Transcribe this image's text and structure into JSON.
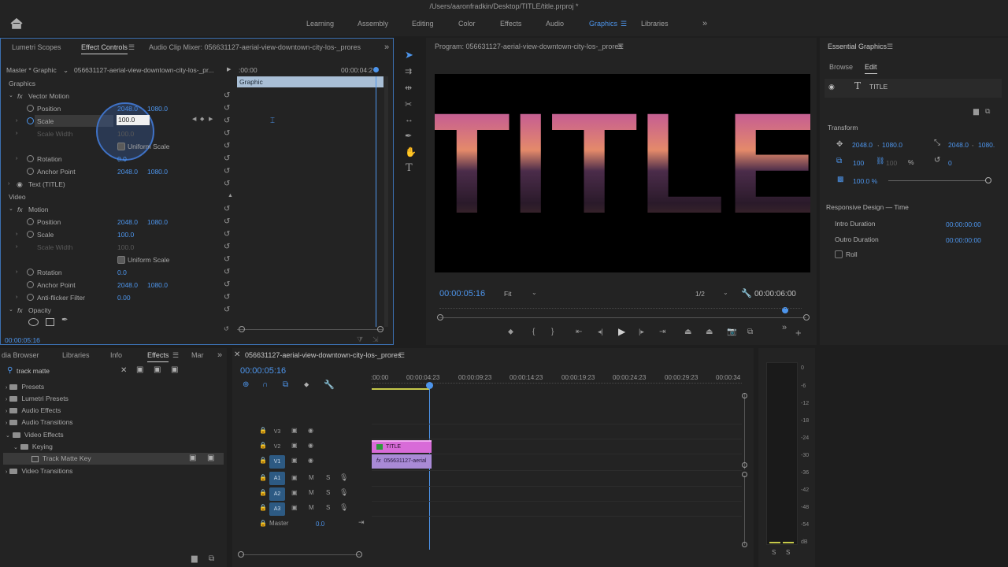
{
  "window": {
    "title": "/Users/aaronfradkin/Desktop/TITLE/title.prproj *"
  },
  "workspaces": [
    "Learning",
    "Assembly",
    "Editing",
    "Color",
    "Effects",
    "Audio",
    "Graphics",
    "Libraries"
  ],
  "overflow": "»",
  "effect_panel": {
    "tabs": [
      "Lumetri Scopes",
      "Effect Controls",
      "Audio Clip Mixer: 056631127-aerial-view-downtown-city-los-_prores"
    ],
    "source": "Master * Graphic",
    "clip": "056631127-aerial-view-downtown-city-los-_pr...",
    "time_start": ":00:00",
    "time_end": "00:00:04:2",
    "graphic_bar": "Graphic",
    "sections": {
      "graphics": "Graphics",
      "vector_motion": "Vector Motion",
      "text": "Text (TITLE)",
      "video": "Video",
      "motion": "Motion",
      "anti_flicker": "Anti-flicker Filter",
      "opacity": "Opacity"
    },
    "vector": {
      "position_label": "Position",
      "pos_x": "2048.0",
      "pos_y": "1080.0",
      "scale_label": "Scale",
      "scale_value": "100.0",
      "scale_width_label": "Scale Width",
      "scale_width_value": "100.0",
      "uniform": "Uniform Scale",
      "rotation_label": "Rotation",
      "rotation_value": "0.0",
      "anchor_label": "Anchor Point",
      "anchor_x": "2048.0",
      "anchor_y": "1080.0"
    },
    "motion": {
      "position_label": "Position",
      "pos_x": "2048.0",
      "pos_y": "1080.0",
      "scale_label": "Scale",
      "scale_value": "100.0",
      "scale_width_label": "Scale Width",
      "scale_width_value": "100.0",
      "uniform": "Uniform Scale",
      "rotation_label": "Rotation",
      "rotation_value": "0.0",
      "anchor_label": "Anchor Point",
      "anchor_x": "2048.0",
      "anchor_y": "1080.0",
      "anti_value": "0.00"
    },
    "footer_time": "00:00:05:16"
  },
  "program": {
    "title": "Program: 056631127-aerial-view-downtown-city-los-_prores",
    "title_text": "TITLE",
    "timecode": "00:00:05:16",
    "fit": "Fit",
    "resolution": "1/2",
    "duration": "00:00:06:00"
  },
  "essential": {
    "title": "Essential Graphics",
    "tabs": [
      "Browse",
      "Edit"
    ],
    "layer": "TITLE",
    "transform_label": "Transform",
    "pos_x": "2048.0",
    "pos_y": "1080.0",
    "anchor_x": "2048.0",
    "anchor_y": "1080.",
    "scale": "100",
    "scale2": "100",
    "pct": "%",
    "rotation": "0",
    "opacity": "100.0 %",
    "responsive": "Responsive Design — Time",
    "intro_label": "Intro Duration",
    "intro_value": "00:00:00:00",
    "outro_label": "Outro Duration",
    "outro_value": "00:00:00:00",
    "roll": "Roll"
  },
  "effects_browser": {
    "tabs": [
      "dia Browser",
      "Libraries",
      "Info",
      "Effects",
      "Mar"
    ],
    "search": "track matte",
    "items": [
      {
        "label": "Presets",
        "level": 0
      },
      {
        "label": "Lumetri Presets",
        "level": 0
      },
      {
        "label": "Audio Effects",
        "level": 0
      },
      {
        "label": "Audio Transitions",
        "level": 0
      },
      {
        "label": "Video Effects",
        "level": 0
      },
      {
        "label": "Keying",
        "level": 1
      },
      {
        "label": "Track Matte Key",
        "level": 2
      },
      {
        "label": "Video Transitions",
        "level": 0
      }
    ]
  },
  "timeline": {
    "title": "056631127-aerial-view-downtown-city-los-_prores",
    "timecode": "00:00:05:16",
    "ruler": [
      ":00:00",
      "00:00:04:23",
      "00:00:09:23",
      "00:00:14:23",
      "00:00:19:23",
      "00:00:24:23",
      "00:00:29:23",
      "00:00:34"
    ],
    "video_tracks": [
      "V3",
      "V2",
      "V1"
    ],
    "audio_tracks": [
      "A1",
      "A2",
      "A3"
    ],
    "master": "Master",
    "master_value": "0.0",
    "clip_title": "TITLE",
    "clip_video": "056631127-aerial",
    "meter_labels": [
      "0",
      "-6",
      "-12",
      "-18",
      "-24",
      "-30",
      "-36",
      "-42",
      "-48",
      "-54",
      "dB"
    ],
    "meter_solo": [
      "S",
      "S"
    ]
  },
  "colors": {
    "accent": "#4d95ec",
    "title_clip": "#d86bd8",
    "video_clip": "#a98ad6"
  }
}
